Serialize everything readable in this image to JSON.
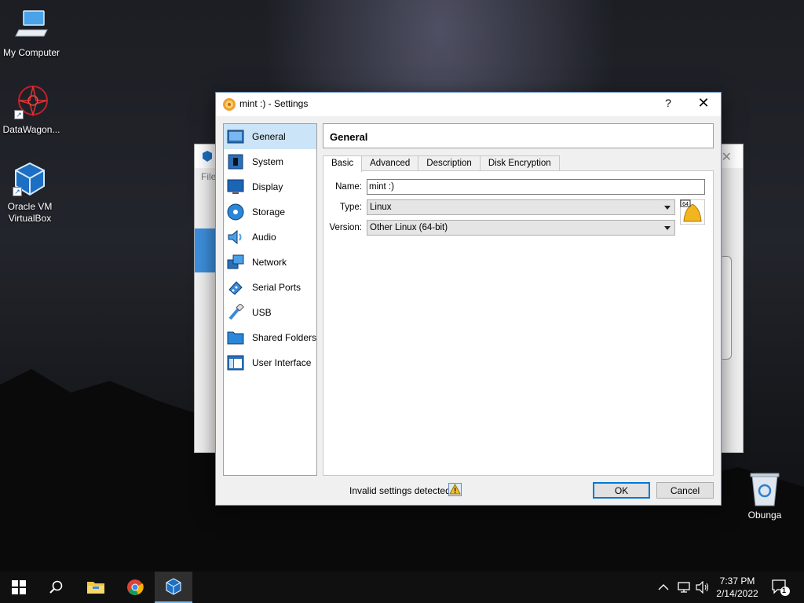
{
  "desktop": {
    "icons": [
      {
        "label": "My Computer"
      },
      {
        "label": "DataWagon..."
      },
      {
        "label": "Oracle VM\nVirtualBox"
      }
    ],
    "recycle_bin_label": "Obunga"
  },
  "background_window": {
    "menu_label": "File"
  },
  "dialog": {
    "title": "mint :) - Settings",
    "help_glyph": "?",
    "close_glyph": "✕",
    "categories": [
      {
        "label": "General",
        "icon": "general-icon",
        "selected": true
      },
      {
        "label": "System",
        "icon": "system-chip-icon"
      },
      {
        "label": "Display",
        "icon": "display-monitor-icon"
      },
      {
        "label": "Storage",
        "icon": "storage-disc-icon"
      },
      {
        "label": "Audio",
        "icon": "audio-speaker-icon"
      },
      {
        "label": "Network",
        "icon": "network-icon"
      },
      {
        "label": "Serial Ports",
        "icon": "serial-port-icon"
      },
      {
        "label": "USB",
        "icon": "usb-icon"
      },
      {
        "label": "Shared Folders",
        "icon": "folder-icon"
      },
      {
        "label": "User Interface",
        "icon": "user-interface-icon"
      }
    ],
    "page_title": "General",
    "tabs": [
      {
        "label": "Basic",
        "active": true
      },
      {
        "label": "Advanced"
      },
      {
        "label": "Description"
      },
      {
        "label": "Disk Encryption"
      }
    ],
    "basic": {
      "name_label": "Name:",
      "name_value": "mint :)",
      "type_label": "Type:",
      "type_value": "Linux",
      "version_label": "Version:",
      "version_value": "Other Linux (64-bit)",
      "os_icon_badge": "64"
    },
    "status_text": "Invalid settings detected",
    "ok_label": "OK",
    "cancel_label": "Cancel"
  },
  "taskbar": {
    "time": "7:37 PM",
    "date": "2/14/2022",
    "notification_count": "1"
  },
  "colors": {
    "accent": "#0078d7",
    "selection": "#cce4f7",
    "taskbar": "#101010"
  }
}
